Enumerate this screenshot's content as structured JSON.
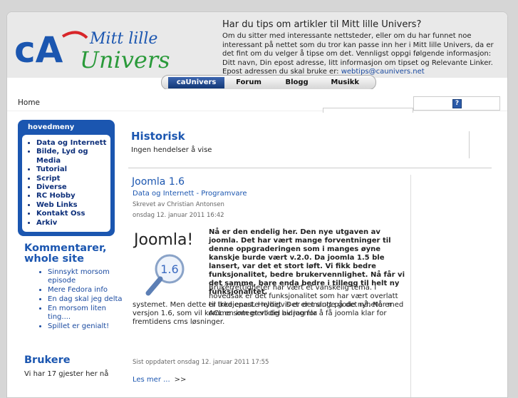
{
  "logo": {
    "abbr": "cA",
    "line1": "Mitt lille",
    "line2": "Univers"
  },
  "tips": {
    "title": "Har du tips om artikler til Mitt lille Univers?",
    "text": "Om du sitter med interessante nettsteder, eller om du har funnet noe interessant på nettet som du tror kan passe inn her i Mitt lille Univers, da er det fint om du velger å tipse om det. Vennligst oppgi følgende informasjon: Ditt navn, Din epost adresse, litt informasjon om tipset og Relevante Linker. Epost adressen du skal bruke er:",
    "email": "webtips@caunivers.net"
  },
  "nav": {
    "tabs": [
      "caUnivers",
      "Forum",
      "Blogg",
      "Musikk"
    ],
    "active": 0
  },
  "breadcrumb": "Home",
  "help_icon": "?",
  "mainmenu": {
    "title": "hovedmeny",
    "items": [
      "Data og Internett",
      "Bilde, Lyd og Media",
      "Tutorial",
      "Script",
      "Diverse",
      "RC Hobby",
      "Web Links",
      "Kontakt Oss",
      "Arkiv"
    ]
  },
  "comments": {
    "title_line1": "Kommentarer,",
    "title_line2": "whole site",
    "items": [
      "Sinnsykt morsom episode",
      "Mere Fedora info",
      "En dag skal jeg delta",
      "En morsom liten ting....",
      "Spillet er genialt!"
    ]
  },
  "users": {
    "title": "Brukere",
    "text": "Vi har 17 gjester her nå"
  },
  "history": {
    "title": "Historisk",
    "text": "Ingen hendelser å vise"
  },
  "article": {
    "title": "Joomla 1.6",
    "category": "Data og Internett - Programvare",
    "author": "Skrevet av Christian Antonsen",
    "date": "onsdag 12. januar 2011 16:42",
    "image_text": "Joomla!",
    "image_version": "1.6",
    "intro": "Nå er den endelig her. Den nye utgaven av joomla. Det har vært mange forventninger til denne oppgraderingen som i manges øyne kanskje burde vært v.2.0. Da joomla 1.5 ble lansert, var det et stort løft. Vi fikk bedre funksjonalitet, bedre brukervennlighet. Nå får vi det samme, bare enda bedre i tillegg til helt ny funksjonalitet.",
    "body_wrap": "Brukerrettigheter har vært et vanskelig tema. I hovedsak er det funksjonalitet som har vært overlatt til tredjepart. Heldigvis er det slutt på det nå. Nå er ACL en integrert del av joomla",
    "body_full": "systemet. Men dette er ikke eneste nyhet. Det er mange gode nyheter med versjon 1.6, som vil komme som et viktig bidrag for å få joomla klar for fremtidens cms løsninger.",
    "updated": "Sist oppdatert onsdag 12. januar 2011 17:55",
    "more": "Les mer ...",
    "more_arrow": ">>"
  },
  "colors": {
    "brand_blue": "#1b56b0",
    "logo_red": "#d8262a"
  }
}
